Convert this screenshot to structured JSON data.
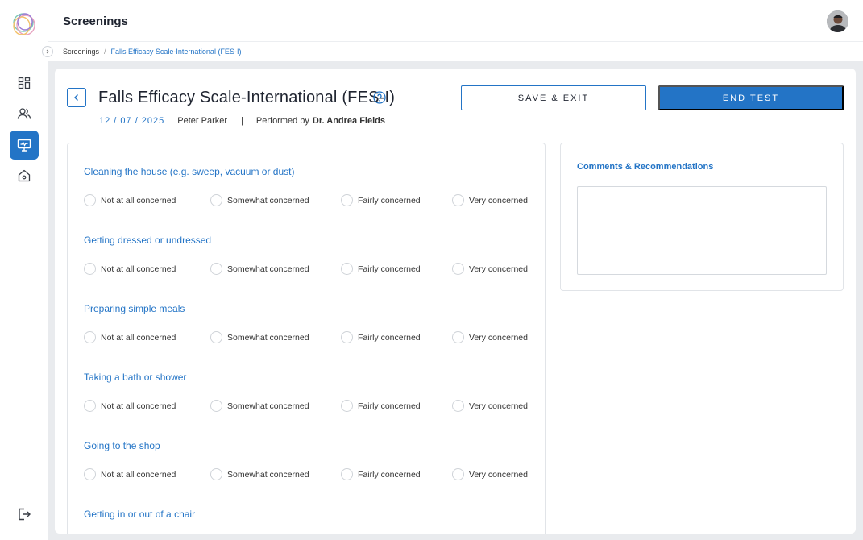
{
  "app": {
    "page_title": "Screenings"
  },
  "breadcrumb": {
    "root": "Screenings",
    "separator": "/",
    "current": "Falls Efficacy Scale-International (FES-I)"
  },
  "sidebar": {
    "items": [
      {
        "name": "dashboard",
        "icon": "dashboard-icon"
      },
      {
        "name": "patients",
        "icon": "users-icon"
      },
      {
        "name": "screenings",
        "icon": "monitor-icon",
        "active": true
      },
      {
        "name": "home",
        "icon": "home-icon"
      }
    ],
    "logout_icon": "logout-icon"
  },
  "test": {
    "title": "Falls Efficacy Scale-International (FES-I)",
    "date": "12 / 07 / 2025",
    "patient": "Peter Parker",
    "pipe": "|",
    "performed_by_label": "Performed by",
    "doctor": "Dr. Andrea Fields",
    "save_label": "SAVE & EXIT",
    "end_label": "END TEST"
  },
  "options": [
    "Not at all concerned",
    "Somewhat concerned",
    "Fairly concerned",
    "Very concerned"
  ],
  "questions": [
    "Cleaning the house (e.g. sweep, vacuum or dust)",
    "Getting dressed or undressed",
    "Preparing simple meals",
    "Taking a bath or shower",
    "Going to the shop",
    "Getting in or out of a chair"
  ],
  "comments": {
    "title": "Comments & Recommendations",
    "value": ""
  },
  "colors": {
    "accent": "#2374c6",
    "background": "#e9ebee"
  }
}
